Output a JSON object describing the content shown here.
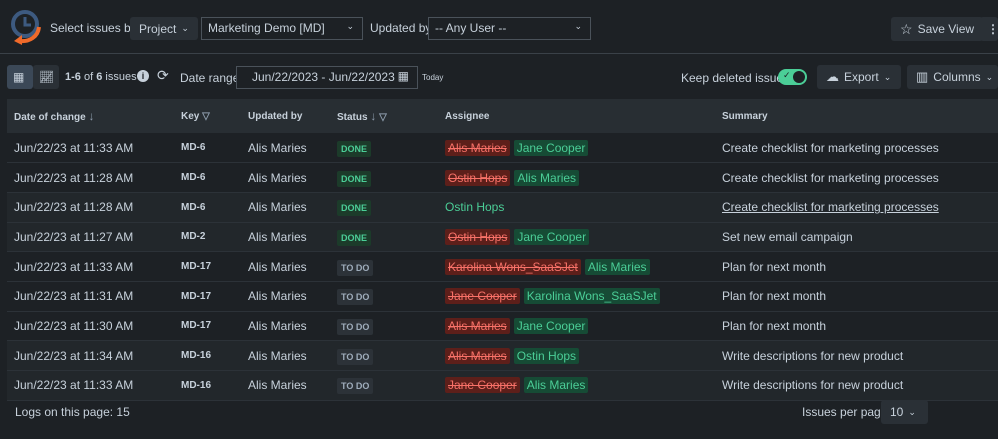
{
  "header": {
    "select_label": "Select issues by:",
    "select_by": "Project",
    "project": "Marketing Demo [MD]",
    "updated_by_label": "Updated by:",
    "updated_by": "-- Any User --",
    "save_view": "Save View"
  },
  "toolbar": {
    "range_prefix": "1-6",
    "of": " of ",
    "total": "6",
    "issues": " issues",
    "date_range_label": "Date range:",
    "date_range": "Jun/22/2023 - Jun/22/2023",
    "today": "Today",
    "keep_deleted": "Keep deleted issues",
    "keep_deleted_on": true,
    "export": "Export",
    "columns": "Columns"
  },
  "table": {
    "headers": [
      "Date of change",
      "Key",
      "Updated by",
      "Status",
      "Assignee",
      "Summary"
    ],
    "rows": [
      {
        "date": "Jun/22/23 at 11:33 AM",
        "key": "MD-6",
        "by": "Alis Maries",
        "status": "DONE",
        "old": "Alis Maries",
        "new": "Jane Cooper",
        "summary": "Create checklist for marketing processes"
      },
      {
        "date": "Jun/22/23 at 11:28 AM",
        "key": "MD-6",
        "by": "Alis Maries",
        "status": "DONE",
        "old": "Ostin Hops",
        "new": "Alis Maries",
        "summary": "Create checklist for marketing processes"
      },
      {
        "date": "Jun/22/23 at 11:28 AM",
        "key": "MD-6",
        "by": "Alis Maries",
        "status": "DONE",
        "old": "",
        "new": "Ostin Hops",
        "summary": "Create checklist for marketing processes"
      },
      {
        "date": "Jun/22/23 at 11:27 AM",
        "key": "MD-2",
        "by": "Alis Maries",
        "status": "DONE",
        "old": "Ostin Hops",
        "new": "Jane Cooper",
        "summary": "Set new email campaign"
      },
      {
        "date": "Jun/22/23 at 11:33 AM",
        "key": "MD-17",
        "by": "Alis Maries",
        "status": "TO DO",
        "old": "Karolina Wons_SaaSJet",
        "new": "Alis Maries",
        "summary": "Plan for next month"
      },
      {
        "date": "Jun/22/23 at 11:31 AM",
        "key": "MD-17",
        "by": "Alis Maries",
        "status": "TO DO",
        "old": "Jane Cooper",
        "new": "Karolina Wons_SaaSJet",
        "summary": "Plan for next month"
      },
      {
        "date": "Jun/22/23 at 11:30 AM",
        "key": "MD-17",
        "by": "Alis Maries",
        "status": "TO DO",
        "old": "Alis Maries",
        "new": "Jane Cooper",
        "summary": "Plan for next month"
      },
      {
        "date": "Jun/22/23 at 11:34 AM",
        "key": "MD-16",
        "by": "Alis Maries",
        "status": "TO DO",
        "old": "Alis Maries",
        "new": "Ostin Hops",
        "summary": "Write descriptions for new product"
      },
      {
        "date": "Jun/22/23 at 11:33 AM",
        "key": "MD-16",
        "by": "Alis Maries",
        "status": "TO DO",
        "old": "Jane Cooper",
        "new": "Alis Maries",
        "summary": "Write descriptions for new product"
      }
    ]
  },
  "footer": {
    "logs": "Logs on this page: 15",
    "per_page_label": "Issues per page:",
    "per_page": "10"
  }
}
